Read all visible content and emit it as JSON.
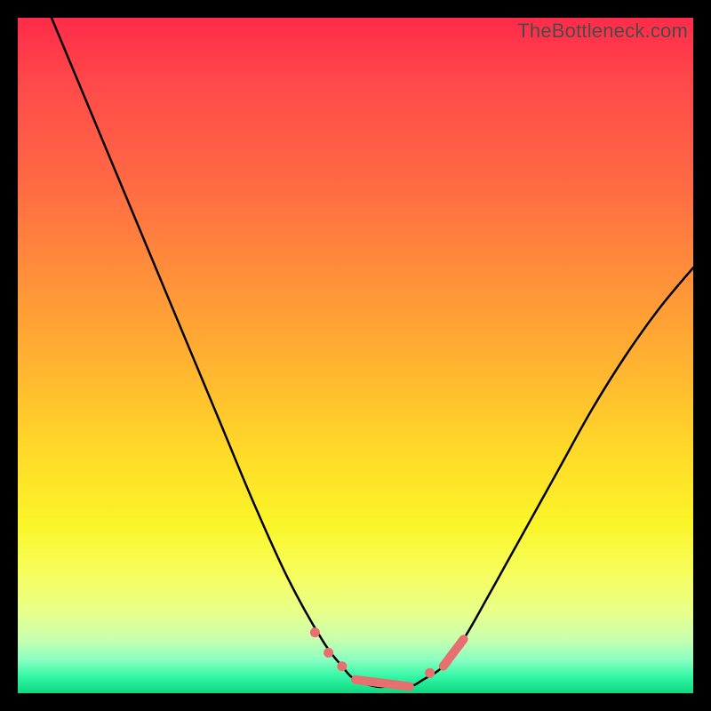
{
  "watermark": "TheBottleneck.com",
  "colors": {
    "accent": "#e76f6f",
    "curve": "#000000"
  },
  "chart_data": {
    "type": "line",
    "title": "",
    "xlabel": "",
    "ylabel": "",
    "xlim": [
      0,
      100
    ],
    "ylim": [
      0,
      100
    ],
    "grid": false,
    "legend": false,
    "series": [
      {
        "name": "bottleneck-curve",
        "x": [
          5,
          10,
          15,
          20,
          25,
          30,
          35,
          40,
          45,
          48,
          50,
          53,
          55,
          58,
          60,
          63,
          66,
          70,
          75,
          80,
          85,
          90,
          95,
          100
        ],
        "y": [
          100,
          88,
          76,
          64,
          52,
          40,
          28,
          17,
          8,
          4,
          2,
          1,
          1,
          1,
          2,
          4,
          8,
          15,
          24,
          33,
          42,
          50,
          57,
          63
        ]
      }
    ],
    "accent_segments": [
      {
        "x": [
          50,
          58
        ],
        "y": [
          2,
          1
        ]
      },
      {
        "x": [
          63,
          66
        ],
        "y": [
          4,
          8
        ]
      }
    ],
    "accent_points": [
      {
        "x": 44,
        "y": 9
      },
      {
        "x": 46,
        "y": 6
      },
      {
        "x": 48,
        "y": 4
      },
      {
        "x": 61,
        "y": 3
      }
    ],
    "description": "Asymmetric V-shaped curve over a red-to-green vertical gradient. Minimum (~1) near x≈55; y rises to 100 at far left and ~63 at far right. Pink segments/dots highlight the region near the trough."
  }
}
